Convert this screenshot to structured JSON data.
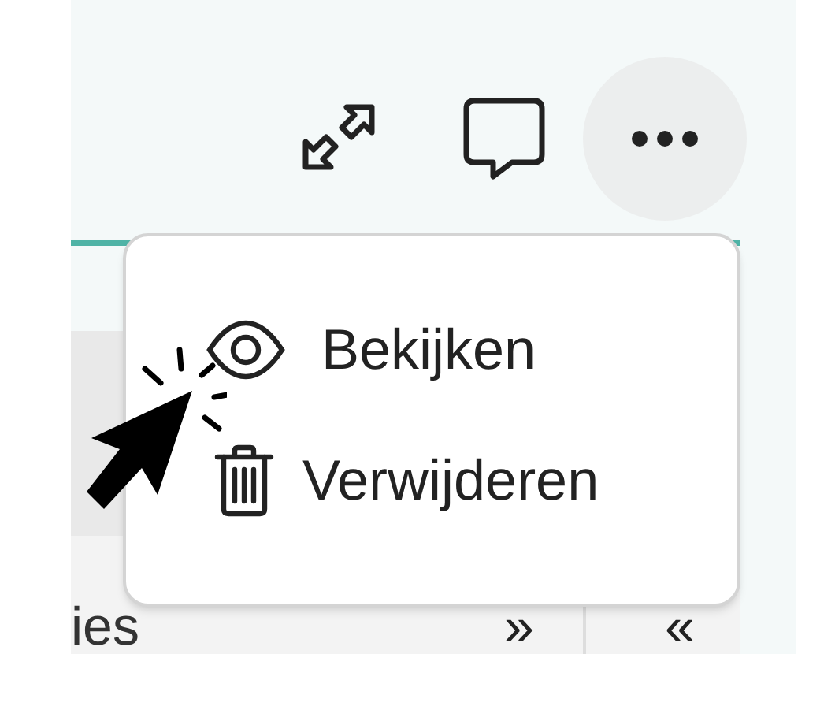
{
  "toolbar": {
    "buttons": [
      {
        "kind": "expand"
      },
      {
        "kind": "comment"
      },
      {
        "kind": "more"
      }
    ]
  },
  "menu": {
    "items": [
      {
        "kind": "view",
        "label": "Bekijken"
      },
      {
        "kind": "delete",
        "label": "Verwijderen"
      }
    ]
  },
  "table": {
    "footer": {
      "column_1": "ies",
      "column_2": "»",
      "column_3": "«"
    }
  }
}
